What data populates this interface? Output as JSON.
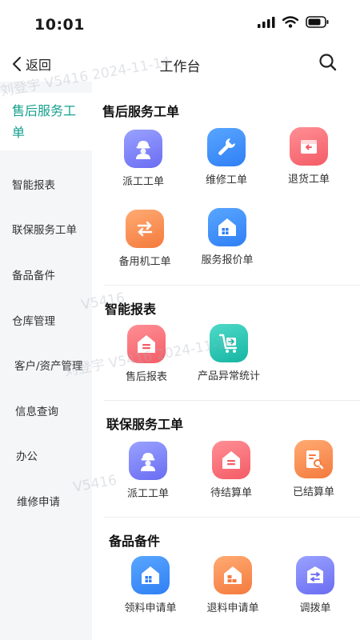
{
  "status_bar": {
    "time": "10:01"
  },
  "header": {
    "back_label": "返回",
    "title": "工作台"
  },
  "sidebar": {
    "items": [
      {
        "label": "售后服务工单"
      },
      {
        "label": "智能报表"
      },
      {
        "label": "联保服务工单"
      },
      {
        "label": "备品备件"
      },
      {
        "label": "仓库管理"
      },
      {
        "label": "客户/资产管理"
      },
      {
        "label": "信息查询"
      },
      {
        "label": "办公"
      },
      {
        "label": "维修申请"
      }
    ]
  },
  "sections": [
    {
      "title": "售后服务工单",
      "tiles": [
        {
          "label": "派工工单",
          "icon": "worker-icon",
          "color": "#6a6cf2"
        },
        {
          "label": "维修工单",
          "icon": "wrench-icon",
          "color": "#2f7ff5"
        },
        {
          "label": "退货工单",
          "icon": "return-box-icon",
          "color": "#f45c66"
        },
        {
          "label": "备用机工单",
          "icon": "swap-icon",
          "color": "#f47a3d"
        },
        {
          "label": "服务报价单",
          "icon": "house-icon",
          "color": "#2f7ff5"
        }
      ]
    },
    {
      "title": "智能报表",
      "tiles": [
        {
          "label": "售后报表",
          "icon": "report-house-icon",
          "color": "#f45c66"
        },
        {
          "label": "产品异常统计",
          "icon": "cart-icon",
          "color": "#15b5a3"
        }
      ]
    },
    {
      "title": "联保服务工单",
      "tiles": [
        {
          "label": "派工工单",
          "icon": "worker-icon",
          "color": "#6a6cf2"
        },
        {
          "label": "待结算单",
          "icon": "report-house-icon",
          "color": "#f45c66"
        },
        {
          "label": "已结算单",
          "icon": "doc-search-icon",
          "color": "#f47a3d"
        }
      ]
    },
    {
      "title": "备品备件",
      "tiles": [
        {
          "label": "领料申请单",
          "icon": "house-icon",
          "color": "#2f7ff5"
        },
        {
          "label": "退料申请单",
          "icon": "warehouse-icon",
          "color": "#f47a3d"
        },
        {
          "label": "调拨单",
          "icon": "transfer-icon",
          "color": "#6a6cf2"
        }
      ]
    }
  ],
  "watermark": {
    "line1": "刘登宇 V5416 2024-11-14",
    "line2": "刘登宇 V5416 2024-11-14",
    "line3": "V5416",
    "line4": "V5416"
  },
  "colors": {
    "accent": "#14a08e",
    "sidebar_bg": "#f5f6f8"
  }
}
